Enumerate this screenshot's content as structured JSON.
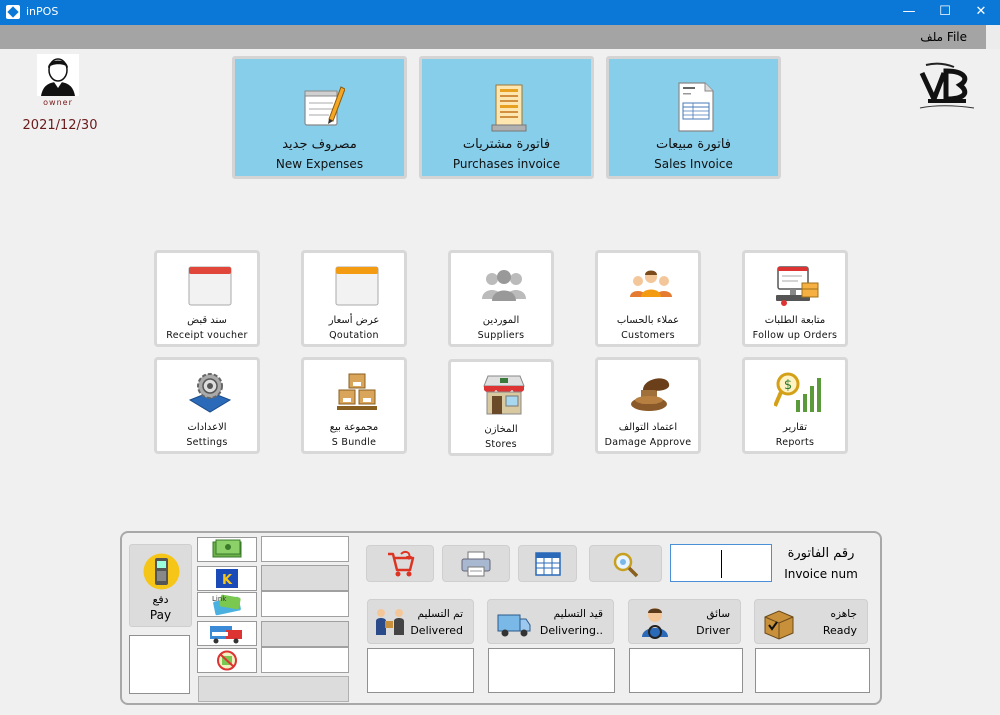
{
  "window": {
    "title": "inPOS",
    "minimize_glyph": "—",
    "maximize_glyph": "☐",
    "close_glyph": "✕"
  },
  "menu": {
    "file_label": "ملف File"
  },
  "user": {
    "name": "owner",
    "date": "2021/12/30"
  },
  "main_buttons": [
    {
      "ar": "فاتورة  مبيعات",
      "en": "Sales Invoice",
      "icon": "invoice-icon"
    },
    {
      "ar": "فاتورة مشتريات",
      "en": "Purchases invoice",
      "icon": "receipt-stack-icon"
    },
    {
      "ar": "مصروف جديد",
      "en": "New Expenses",
      "icon": "notepad-pencil-icon"
    }
  ],
  "tiles": [
    {
      "ar": "متابعة الطلبات",
      "en": "Follow up Orders",
      "icon": "orders-tracking-icon"
    },
    {
      "ar": "عملاء بالحساب",
      "en": "Customers",
      "icon": "customers-icon"
    },
    {
      "ar": "الموردين",
      "en": "Suppliers",
      "icon": "suppliers-icon"
    },
    {
      "ar": "عرض أسعار",
      "en": "Qoutation",
      "icon": "quotation-icon"
    },
    {
      "ar": "سند قبض",
      "en": "Receipt voucher",
      "icon": "receipt-voucher-icon"
    },
    {
      "ar": "تقارير",
      "en": "Reports",
      "icon": "reports-icon"
    },
    {
      "ar": "اعتماد التوالف",
      "en": "Damage Approve",
      "icon": "stamp-icon"
    },
    {
      "ar": "المخازن",
      "en": "Stores",
      "icon": "store-icon"
    },
    {
      "ar": "مجموعة بيع",
      "en": "S Bundle",
      "icon": "boxes-icon"
    },
    {
      "ar": "الاعدادات",
      "en": "Settings",
      "icon": "settings-gear-icon"
    }
  ],
  "pay": {
    "ar": "دفع",
    "en": "Pay"
  },
  "invoice": {
    "label_ar": "رقم الفاتورة",
    "label_en": "Invoice num",
    "value": ""
  },
  "statuses": [
    {
      "ar": "جاهزه",
      "en": "Ready",
      "icon": "package-ready-icon"
    },
    {
      "ar": "سائق",
      "en": "Driver",
      "icon": "driver-icon"
    },
    {
      "ar": "قيد التسليم",
      "en": "Delivering..",
      "icon": "delivery-truck-icon"
    },
    {
      "ar": "تم التسليم",
      "en": "Delivered",
      "icon": "delivered-icon"
    }
  ],
  "colors": {
    "titlebar": "#0b78d8",
    "main_button_bg": "#87ceeb",
    "menubar": "#a4a4a4"
  }
}
